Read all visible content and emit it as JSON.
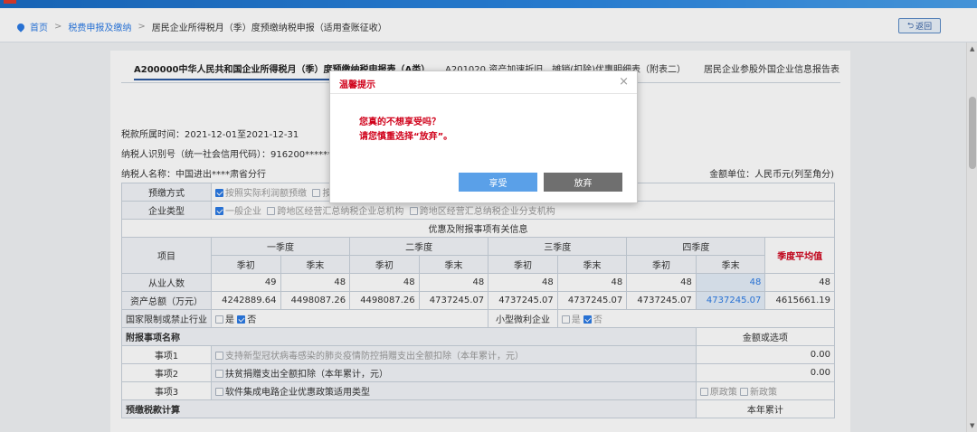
{
  "breadcrumb": {
    "home": "首页",
    "section": "税费申报及缴纳",
    "current": "居民企业所得税月（季）度预缴纳税申报（适用查账征收）"
  },
  "back_button": "返回",
  "tabs": [
    "A200000中华人民共和国企业所得税月（季）度预缴纳税申报表（A类）",
    "A201020 资产加速折旧、摊销(扣除)优惠明细表（附表二）",
    "居民企业参股外国企业信息报告表"
  ],
  "info": {
    "period": "税款所属时间：2021-12-01至2021-12-31",
    "taxpayer_id": "纳税人识别号（统一社会信用代码）：916200******9K",
    "taxpayer_name": "纳税人名称：中国进出****肃省分行",
    "unit": "金额单位：人民币元(列至角分)"
  },
  "form": {
    "prepay_label": "预缴方式",
    "prepay_opt1": "按照实际利润额预缴",
    "prepay_opt2": "按",
    "corp_type_label": "企业类型",
    "corp_opt1": "一般企业",
    "corp_opt2": "跨地区经营汇总纳税企业总机构",
    "corp_opt3": "跨地区经营汇总纳税企业分支机构",
    "section_title": "优惠及附报事项有关信息",
    "item_label": "项目",
    "quarters": [
      "一季度",
      "二季度",
      "三季度",
      "四季度"
    ],
    "start": "季初",
    "end": "季末",
    "avg_label": "季度平均值",
    "employees_label": "从业人数",
    "employees": [
      "49",
      "48",
      "48",
      "48",
      "48",
      "48",
      "48",
      "48",
      "48"
    ],
    "assets_label": "资产总额（万元）",
    "assets": [
      "4242889.64",
      "4498087.26",
      "4498087.26",
      "4737245.07",
      "4737245.07",
      "4737245.07",
      "4737245.07",
      "4737245.07",
      "4615661.19"
    ],
    "restricted_label": "国家限制或禁止行业",
    "yes": "是",
    "no": "否",
    "small_label": "小型微利企业",
    "attach_title": "附报事项名称",
    "amount_title": "金额或选项",
    "items": [
      {
        "no": "事项1",
        "name": "支持新型冠状病毒感染的肺炎疫情防控捐赠支出全额扣除（本年累计，元）",
        "value": "0.00"
      },
      {
        "no": "事项2",
        "name": "扶贫捐赠支出全额扣除（本年累计，元）",
        "value": "0.00"
      },
      {
        "no": "事项3",
        "name": "软件集成电路企业优惠政策适用类型",
        "value": ""
      }
    ],
    "old_policy": "原政策",
    "new_policy": "新政策",
    "bottom_left": "预缴税款计算",
    "bottom_right": "本年累计"
  },
  "dialog": {
    "title": "温馨提示",
    "close": "×",
    "line1": "您真的不想享受吗？",
    "line2": "请您慎重选择“放弃”。",
    "accept": "享受",
    "giveup": "放弃"
  },
  "colors": {
    "accent": "#2c7be5",
    "warning": "#d0021b"
  }
}
